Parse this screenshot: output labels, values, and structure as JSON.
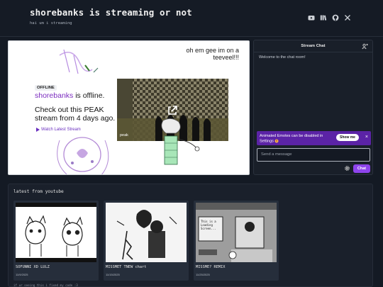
{
  "header": {
    "title": "shorebanks is streaming or not",
    "subtitle": "hai um i streaming",
    "social_icons": [
      "youtube-icon",
      "library-icon",
      "github-icon",
      "x-icon"
    ]
  },
  "player": {
    "doodle_text": "oh em gee im on a teeveel!!!",
    "offline_badge": "OFFLINE",
    "channel_name": "shorebanks",
    "offline_suffix": "is offline.",
    "check_out_text": "Check out this PEAK stream from 4 days ago.",
    "watch_label": "Watch Latest Stream",
    "vod_label": "peak",
    "accent": "#7b2cbf"
  },
  "chat": {
    "title": "Stream Chat",
    "welcome": "Welcome to the chat room!",
    "emote_banner": "Animated Emotes can be disabled in Settings",
    "show_me_label": "Show me",
    "close_label": "×",
    "input_placeholder": "Send a message",
    "send_label": "Chat",
    "send_color": "#8e44ec",
    "banner_color": "#5b23a6"
  },
  "youtube": {
    "title": "latest from youtube",
    "videos": [
      {
        "title": "SOFUNNI XD LULZ",
        "date": "11/9/2025"
      },
      {
        "title": "MISSMET TNEW chart",
        "date": "11/15/2025"
      },
      {
        "title": "MISSME? REMIX",
        "date": "11/25/2025"
      }
    ],
    "thumb_text": "This is a Loading Screen...",
    "footer": "if ur seeing this i fixed my code :3"
  }
}
